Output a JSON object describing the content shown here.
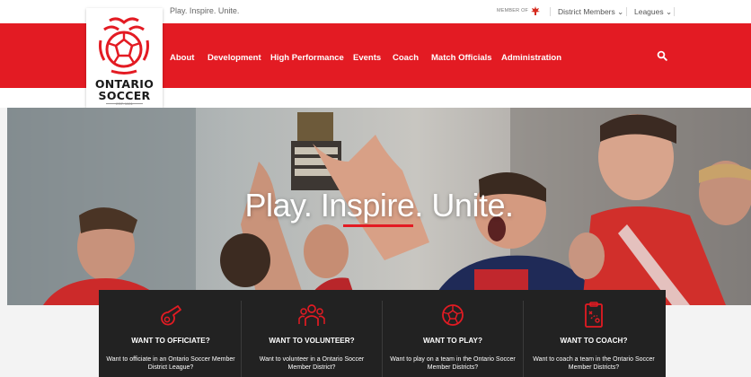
{
  "topbar": {
    "tagline": "Play. Inspire. Unite.",
    "member_of": "MEMBER OF",
    "dropdowns": [
      "District Members ⌄",
      "Leagues ⌄"
    ]
  },
  "logo": {
    "line1": "ONTARIO",
    "line2": "SOCCER",
    "est": "EST. 1901"
  },
  "nav": {
    "items": [
      "About",
      "Development",
      "High Performance",
      "Events",
      "Coach",
      "Match Officials",
      "Administration"
    ]
  },
  "hero": {
    "title": "Play. Inspire. Unite."
  },
  "cards": [
    {
      "icon": "whistle-icon",
      "title": "WANT TO OFFICIATE?",
      "desc": "Want to officiate in an Ontario Soccer Member District League?"
    },
    {
      "icon": "volunteers-icon",
      "title": "WANT TO VOLUNTEER?",
      "desc": "Want to volunteer in a Ontario Soccer Member District?"
    },
    {
      "icon": "soccer-ball-icon",
      "title": "WANT TO PLAY?",
      "desc": "Want to play on a team in the Ontario Soccer Member Districts?"
    },
    {
      "icon": "tactics-board-icon",
      "title": "WANT TO COACH?",
      "desc": "Want to coach a team in the Ontario Soccer Member Districts?"
    }
  ],
  "colors": {
    "brand_red": "#e31b23",
    "card_bg": "#222222"
  }
}
